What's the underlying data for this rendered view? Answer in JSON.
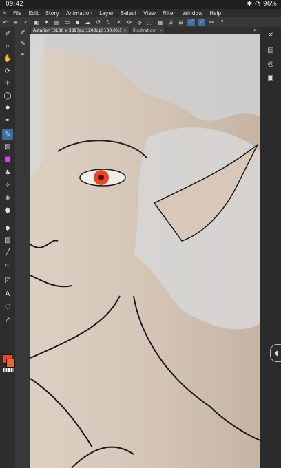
{
  "status": {
    "time": "09:42",
    "battery": "96%"
  },
  "menu": [
    "File",
    "Edit",
    "Story",
    "Animation",
    "Layer",
    "Select",
    "View",
    "Filter",
    "Window",
    "Help"
  ],
  "tabs": [
    {
      "label": "Astarion (3186 x 3897px 1200dpi 100.0%)",
      "active": true
    },
    {
      "label": "Illustration*",
      "active": false
    }
  ],
  "colors": {
    "main": "#e8462a",
    "sub": "#e06a30",
    "canvas_bg": "#c8b8a8",
    "accent": "#3e6fa0"
  },
  "tools_left": [
    "eyedropper-icon",
    "zoom-icon",
    "hand-icon",
    "rotate-icon",
    "move-icon",
    "lasso-icon",
    "magic-wand-icon",
    "pen-icon",
    "brush-icon",
    "fill-icon",
    "gradient-icon",
    "eraser-icon",
    "blend-icon",
    "shape-icon",
    "text-icon",
    "balloon-icon",
    "ruler-icon",
    "correct-line-icon",
    "frame-icon",
    "color-set-icon"
  ],
  "subtools": [
    "eyedropper-sub-icon",
    "brush-sub-icon",
    "pen-sub-icon",
    "sub-icon-4"
  ]
}
